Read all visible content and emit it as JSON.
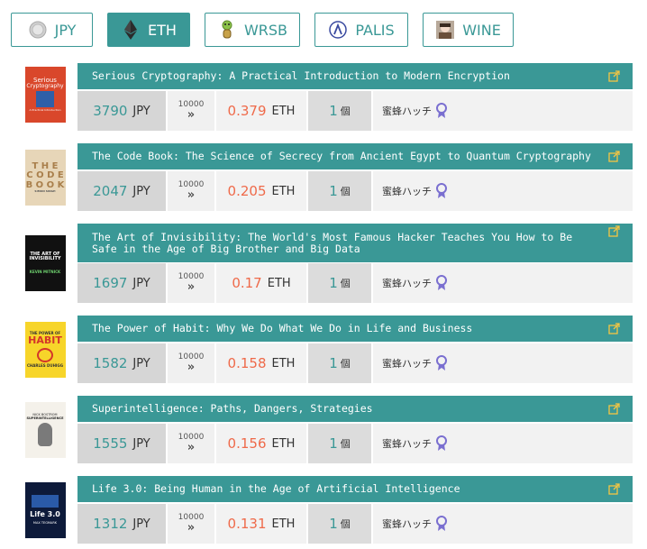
{
  "tabs": [
    {
      "label": "JPY",
      "icon": "coin-icon",
      "active": false
    },
    {
      "label": "ETH",
      "icon": "ethereum-icon",
      "active": true
    },
    {
      "label": "WRSB",
      "icon": "mascot-icon",
      "active": false
    },
    {
      "label": "PALIS",
      "icon": "palis-logo-icon",
      "active": false
    },
    {
      "label": "WINE",
      "icon": "wine-avatar-icon",
      "active": false
    }
  ],
  "colors": {
    "accent": "#3a9896",
    "eth_price": "#ef6a4a",
    "badge": "#7a6fd0"
  },
  "price_unit_jpy": "JPY",
  "price_unit_eth": "ETH",
  "count_unit": "個",
  "quantity_label": "10000",
  "items": [
    {
      "title": "Serious Cryptography: A Practical Introduction to Modern Encryption",
      "cover_text": [
        "Serious",
        "Cryptography",
        "A Practical Introduction",
        "to Modern Encryption"
      ],
      "price_jpy": "3790",
      "price_eth": "0.379",
      "count": "1",
      "seller": "蜜蜂ハッチ"
    },
    {
      "title": "The Code Book: The Science of Secrecy from Ancient Egypt to Quantum Cryptography",
      "cover_text": [
        "T H E",
        "C O D E",
        "B O O K",
        "SIMON SINGH"
      ],
      "price_jpy": "2047",
      "price_eth": "0.205",
      "count": "1",
      "seller": "蜜蜂ハッチ"
    },
    {
      "title": "The Art of Invisibility: The World's Most Famous Hacker Teaches You How to Be Safe in the Age of Big Brother and Big Data",
      "cover_text": [
        "THE ART OF",
        "INVISIBILITY",
        "KEVIN MITNICK"
      ],
      "price_jpy": "1697",
      "price_eth": "0.17",
      "count": "1",
      "seller": "蜜蜂ハッチ"
    },
    {
      "title": "The Power of Habit: Why We Do What We Do in Life and Business",
      "cover_text": [
        "THE POWER OF",
        "HABIT",
        "CHARLES DUHIGG"
      ],
      "price_jpy": "1582",
      "price_eth": "0.158",
      "count": "1",
      "seller": "蜜蜂ハッチ"
    },
    {
      "title": "Superintelligence: Paths, Dangers, Strategies",
      "cover_text": [
        "NICK BOSTROM",
        "SUPERINTELLIGENCE"
      ],
      "price_jpy": "1555",
      "price_eth": "0.156",
      "count": "1",
      "seller": "蜜蜂ハッチ"
    },
    {
      "title": "Life 3.0: Being Human in the Age of Artificial Intelligence",
      "cover_text": [
        "Life 3.0",
        "MAX TEGMARK"
      ],
      "price_jpy": "1312",
      "price_eth": "0.131",
      "count": "1",
      "seller": "蜜蜂ハッチ"
    }
  ]
}
